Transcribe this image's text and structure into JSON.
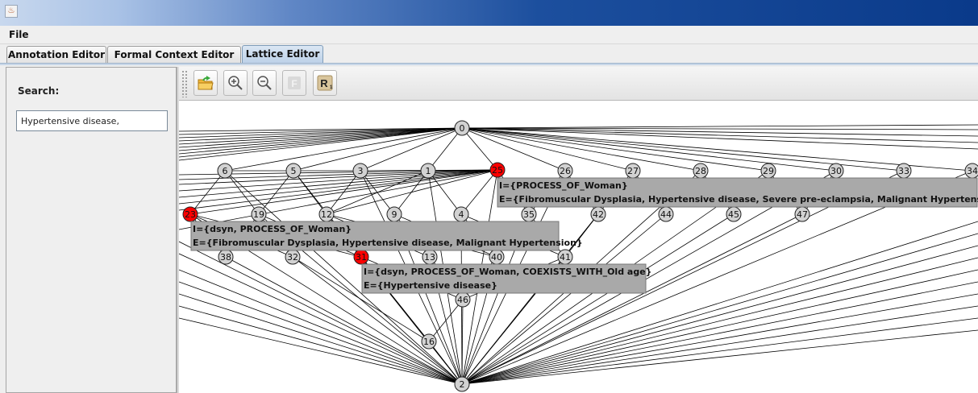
{
  "window": {
    "title": ""
  },
  "menu": {
    "file_label": "File"
  },
  "tabs": [
    {
      "label": "Annotation Editor",
      "active": false
    },
    {
      "label": "Formal Context Editor",
      "active": false
    },
    {
      "label": "Lattice Editor",
      "active": true
    }
  ],
  "left_panel": {
    "search_label": "Search:",
    "search_value": "Hypertensive disease,"
  },
  "toolbar": {
    "buttons": [
      {
        "name": "open-folder-icon"
      },
      {
        "name": "zoom-in-icon"
      },
      {
        "name": "zoom-out-icon"
      },
      {
        "name": "f-icon",
        "label": "F"
      },
      {
        "name": "r-icon",
        "label": "R"
      }
    ]
  },
  "lattice": {
    "nodes": [
      {
        "id": "0",
        "highlighted": false
      },
      {
        "id": "6",
        "highlighted": false
      },
      {
        "id": "5",
        "highlighted": false
      },
      {
        "id": "3",
        "highlighted": false
      },
      {
        "id": "1",
        "highlighted": false
      },
      {
        "id": "25",
        "highlighted": true
      },
      {
        "id": "26",
        "highlighted": false
      },
      {
        "id": "27",
        "highlighted": false
      },
      {
        "id": "28",
        "highlighted": false
      },
      {
        "id": "29",
        "highlighted": false
      },
      {
        "id": "30",
        "highlighted": false
      },
      {
        "id": "33",
        "highlighted": false
      },
      {
        "id": "34",
        "highlighted": false
      },
      {
        "id": "23",
        "highlighted": true
      },
      {
        "id": "19",
        "highlighted": false
      },
      {
        "id": "12",
        "highlighted": false
      },
      {
        "id": "9",
        "highlighted": false
      },
      {
        "id": "4",
        "highlighted": false
      },
      {
        "id": "35",
        "highlighted": false
      },
      {
        "id": "42",
        "highlighted": false
      },
      {
        "id": "44",
        "highlighted": false
      },
      {
        "id": "45",
        "highlighted": false
      },
      {
        "id": "47",
        "highlighted": false
      },
      {
        "id": "38",
        "highlighted": false
      },
      {
        "id": "32",
        "highlighted": false
      },
      {
        "id": "31",
        "highlighted": true
      },
      {
        "id": "13",
        "highlighted": false
      },
      {
        "id": "40",
        "highlighted": false
      },
      {
        "id": "41",
        "highlighted": false
      },
      {
        "id": "46",
        "highlighted": false
      },
      {
        "id": "16",
        "highlighted": false
      },
      {
        "id": "2",
        "highlighted": false
      }
    ],
    "tooltips": [
      {
        "intent": "I={PROCESS_OF_Woman}",
        "extent": "E={Fibromuscular Dysplasia, Hypertensive disease, Severe pre-eclampsia, Malignant Hypertension}"
      },
      {
        "intent": "I={dsyn, PROCESS_OF_Woman}",
        "extent": "E={Fibromuscular Dysplasia, Hypertensive disease, Malignant Hypertension}"
      },
      {
        "intent": "I={dsyn, PROCESS_OF_Woman, COEXISTS_WITH_Old age}",
        "extent": "E={Hypertensive disease}"
      }
    ],
    "colors": {
      "node_fill": "#d2d2d2",
      "highlight_fill": "#ff0000",
      "tooltip_bg": "#a9a9a9",
      "edge": "#000000"
    }
  }
}
